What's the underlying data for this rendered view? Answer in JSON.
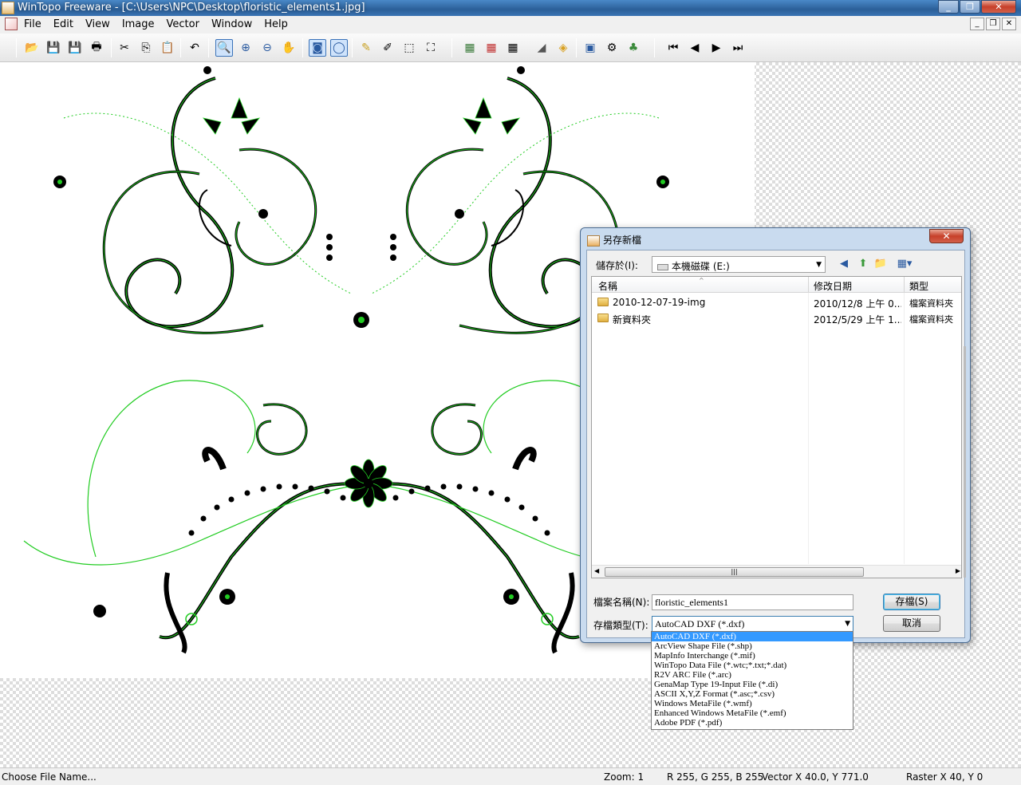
{
  "window": {
    "title": "WinTopo Freeware - [C:\\Users\\NPC\\Desktop\\floristic_elements1.jpg]"
  },
  "menu": [
    "File",
    "Edit",
    "View",
    "Image",
    "Vector",
    "Window",
    "Help"
  ],
  "toolbar": {
    "icons": [
      "open-icon",
      "save-icon",
      "save-as-icon",
      "print-icon",
      "cut-icon",
      "copy-icon",
      "paste-icon",
      "undo-icon",
      "zoom-select-icon",
      "zoom-in-icon",
      "zoom-out-icon",
      "pan-hand-icon",
      "view-raster-icon",
      "view-vector-icon",
      "pencil-icon",
      "draw-line-icon",
      "erase-icon",
      "crop-icon",
      "vectorize-1-icon",
      "vectorize-2-icon",
      "vectorize-3-icon",
      "layer-1-icon",
      "layer-2-icon",
      "options-icon",
      "settings-icon",
      "tree-icon",
      "first-icon",
      "prev-icon",
      "next-icon",
      "last-icon"
    ]
  },
  "dialog": {
    "title": "另存新檔",
    "save_in_label": "儲存於(I):",
    "save_in_value": "本機磁碟 (E:)",
    "columns": [
      "名稱",
      "修改日期",
      "類型"
    ],
    "files": [
      {
        "name": "2010-12-07-19-img",
        "date": "2010/12/8 上午 0...",
        "type": "檔案資料夾"
      },
      {
        "name": "新資料夾",
        "date": "2012/5/29 上午 1...",
        "type": "檔案資料夾"
      }
    ],
    "filename_label": "檔案名稱(N):",
    "filename_value": "floristic_elements1",
    "filetype_label": "存檔類型(T):",
    "filetype_value": "AutoCAD DXF (*.dxf)",
    "save_button": "存檔(S)",
    "cancel_button": "取消",
    "filetype_options": [
      "AutoCAD DXF (*.dxf)",
      "ArcView Shape File (*.shp)",
      "MapInfo Interchange (*.mif)",
      "WinTopo Data File (*.wtc;*.txt;*.dat)",
      "R2V ARC File (*.arc)",
      "GenaMap Type 19-Input File (*.di)",
      "ASCII X,Y,Z Format (*.asc;*.csv)",
      "Windows MetaFile (*.wmf)",
      "Enhanced Windows MetaFile (*.emf)",
      "Adobe PDF (*.pdf)"
    ]
  },
  "status": {
    "message": "Choose File Name...",
    "zoom": "Zoom: 1",
    "rgb": "R 255, G 255, B 255",
    "vector": "Vector  X 40.0, Y 771.0",
    "raster": "Raster  X 40, Y 0"
  },
  "colors": {
    "vector_line": "#22cc22",
    "raster_line": "#000000",
    "highlight": "#3399ff"
  }
}
